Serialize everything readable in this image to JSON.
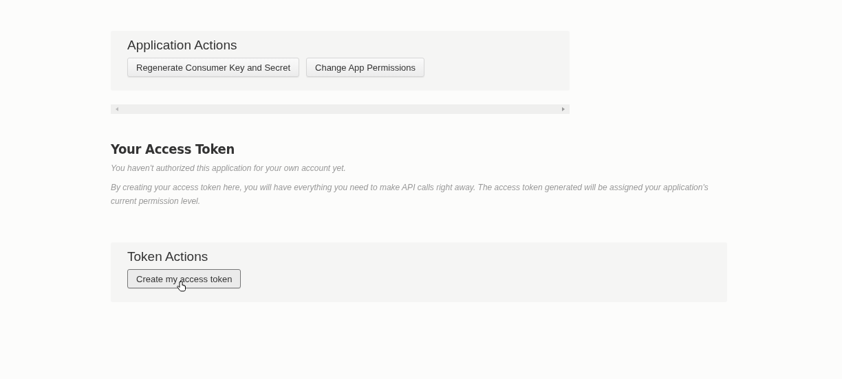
{
  "app_actions": {
    "title": "Application Actions",
    "buttons": [
      "Regenerate Consumer Key and Secret",
      "Change App Permissions"
    ]
  },
  "access_token": {
    "title": "Your Access Token",
    "notes": [
      "You haven't authorized this application for your own account yet.",
      "By creating your access token here, you will have everything you need to make API calls right away. The access token generated will be assigned your application's current permission level."
    ]
  },
  "token_actions": {
    "title": "Token Actions",
    "buttons": [
      "Create my access token"
    ]
  }
}
